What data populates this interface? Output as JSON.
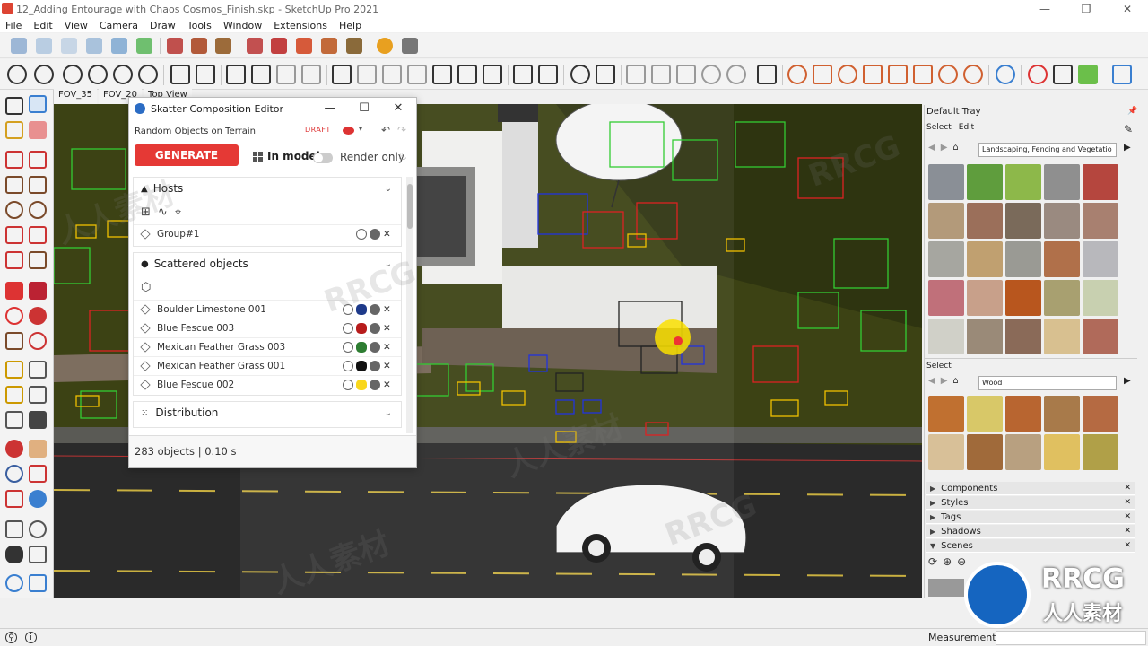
{
  "window": {
    "title": "12_Adding Entourage with Chaos Cosmos_Finish.skp - SketchUp Pro 2021"
  },
  "menu": [
    "File",
    "Edit",
    "View",
    "Camera",
    "Draw",
    "Tools",
    "Window",
    "Extensions",
    "Help"
  ],
  "scene_tabs": [
    "FOV_35",
    "FOV_20",
    "Top View"
  ],
  "scatter": {
    "title": "Skatter Composition Editor",
    "composition_name": "Random Objects on Terrain",
    "draft_label": "DRAFT",
    "generate_label": "GENERATE",
    "in_model_label": "In model",
    "render_only_label": "Render only",
    "hosts_label": "Hosts",
    "host_item": "Group#1",
    "scattered_label": "Scattered objects",
    "objects": [
      {
        "name": "Boulder Limestone 001",
        "eye": "#1e3a8a"
      },
      {
        "name": "Blue Fescue 003",
        "eye": "#b71c1c"
      },
      {
        "name": "Mexican Feather Grass 003",
        "eye": "#2e7d32"
      },
      {
        "name": "Mexican Feather Grass 001",
        "eye": "#111111"
      },
      {
        "name": "Blue Fescue 002",
        "eye": "#f9d71c"
      }
    ],
    "distribution_label": "Distribution",
    "footer": "283 objects | 0.10 s"
  },
  "tray": {
    "title": "Default Tray",
    "select_tab": "Select",
    "edit_tab": "Edit",
    "category_1": "Landscaping, Fencing and Vegetatio",
    "select_label": "Select",
    "category_2": "Wood",
    "panels": [
      "Components",
      "Styles",
      "Tags",
      "Shadows",
      "Scenes"
    ]
  },
  "status": {
    "measurements_label": "Measurements"
  },
  "watermarks": {
    "text_cn": "人人素材",
    "text_en": "RRCG"
  },
  "colors": {
    "accent_red": "#e53935",
    "wire_green": "#33cc33",
    "wire_red": "#dd2222",
    "wire_blue": "#2233dd",
    "wire_yellow": "#f0c000",
    "terrain": "#3a3f12"
  }
}
